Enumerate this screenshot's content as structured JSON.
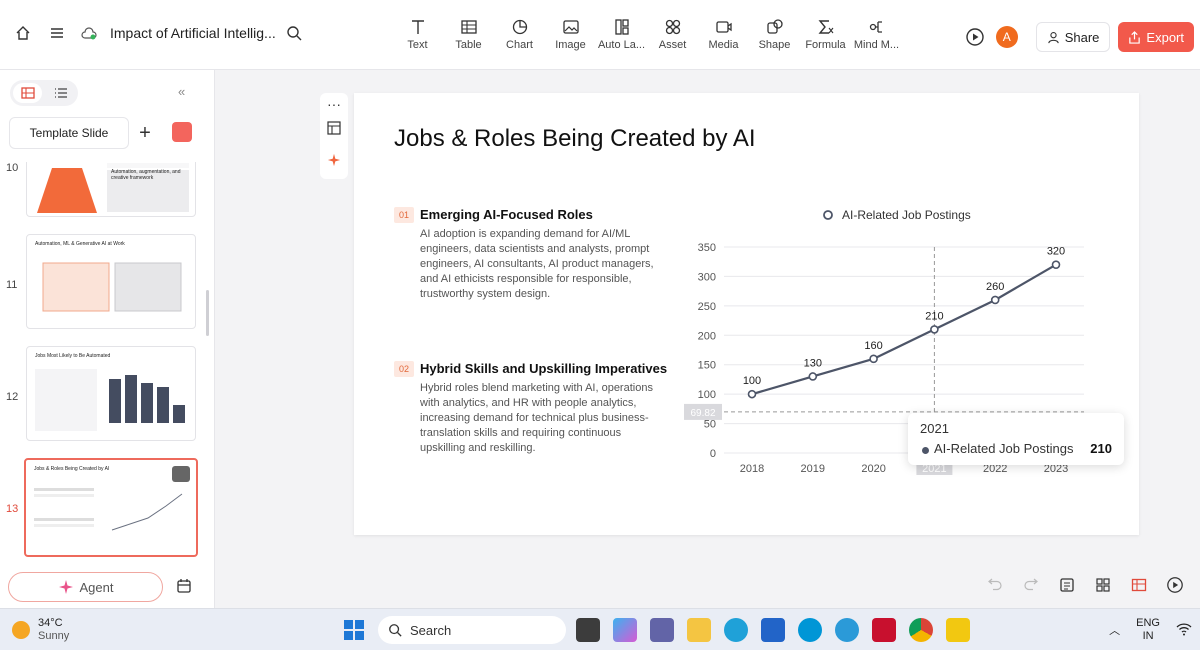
{
  "header": {
    "doc_title": "Impact of Artificial Intellig...",
    "tools": [
      {
        "label": "Text",
        "icon": "text-icon"
      },
      {
        "label": "Table",
        "icon": "table-icon"
      },
      {
        "label": "Chart",
        "icon": "chart-icon"
      },
      {
        "label": "Image",
        "icon": "image-icon"
      },
      {
        "label": "Auto La...",
        "icon": "auto-layout-icon"
      },
      {
        "label": "Asset",
        "icon": "asset-icon"
      },
      {
        "label": "Media",
        "icon": "media-icon"
      },
      {
        "label": "Shape",
        "icon": "shape-icon"
      },
      {
        "label": "Formula",
        "icon": "formula-icon"
      },
      {
        "label": "Mind M...",
        "icon": "mind-map-icon"
      }
    ],
    "avatar_initial": "A",
    "share_label": "Share",
    "export_label": "Export",
    "accent": "#f2594b"
  },
  "left_panel": {
    "template_label": "Template Slide",
    "plus_label": "+",
    "agent_label": "Agent",
    "thumbnails": [
      {
        "num": "10",
        "title": "Automation, augmentation, and creative framework"
      },
      {
        "num": "11",
        "title": "Automation, ML & Generative AI at Work"
      },
      {
        "num": "12",
        "title": "Jobs Most Likely to Be Automated"
      },
      {
        "num": "13",
        "title": "Jobs & Roles Being Created by AI"
      }
    ]
  },
  "slide": {
    "title": "Jobs & Roles Being Created by AI",
    "sections": [
      {
        "num": "01",
        "title": "Emerging AI-Focused Roles",
        "body": "AI adoption is expanding demand for AI/ML engineers, data scientists and analysts, prompt engineers, AI consultants, AI product managers, and AI ethicists responsible for responsible, trustworthy system design."
      },
      {
        "num": "02",
        "title": "Hybrid Skills and Upskilling Imperatives",
        "body": "Hybrid roles blend marketing with AI, operations with analytics, and HR with people analytics, increasing demand for technical plus business-translation skills and requiring continuous upskilling and reskilling."
      }
    ]
  },
  "chart_data": {
    "type": "line",
    "x": [
      "2018",
      "2019",
      "2020",
      "2021",
      "2022",
      "2023"
    ],
    "series": [
      {
        "name": "AI-Related Job Postings",
        "values": [
          100,
          130,
          160,
          210,
          260,
          320
        ]
      }
    ],
    "ylim": [
      0,
      350
    ],
    "yticks": [
      0,
      50,
      100,
      150,
      200,
      250,
      300,
      350
    ],
    "legend": "top",
    "grid": true,
    "color": "#4d5568",
    "hover": {
      "year": "2021",
      "series": "AI-Related Job Postings",
      "value": "210",
      "y_readout": "69.82"
    }
  },
  "taskbar": {
    "temp": "34°C",
    "condition": "Sunny",
    "search_label": "Search",
    "lang_1": "ENG",
    "lang_2": "IN"
  }
}
